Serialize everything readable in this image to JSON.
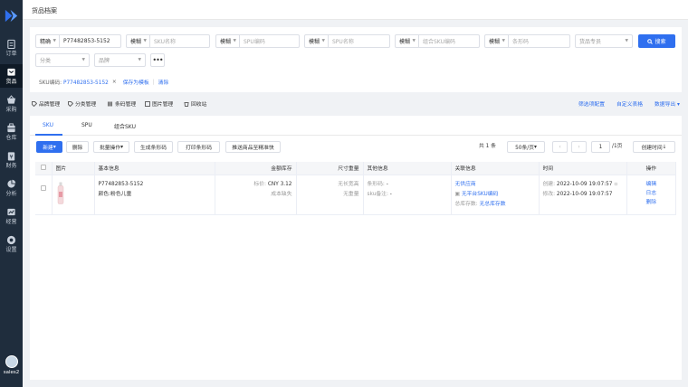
{
  "app": {
    "page_title": "货品档案",
    "user": "sales2"
  },
  "colors": {
    "brand": "#2f6fef",
    "sidebar": "#1f2d3d"
  },
  "sidebar": {
    "items": [
      {
        "label": "订单",
        "icon": "clipboard-icon"
      },
      {
        "label": "货品",
        "icon": "box-icon",
        "active": true
      },
      {
        "label": "采购",
        "icon": "basket-icon"
      },
      {
        "label": "仓库",
        "icon": "warehouse-icon"
      },
      {
        "label": "财务",
        "icon": "wallet-icon"
      },
      {
        "label": "分析",
        "icon": "pie-chart-icon"
      },
      {
        "label": "经营",
        "icon": "trend-icon"
      },
      {
        "label": "设置",
        "icon": "gear-icon"
      }
    ]
  },
  "search": {
    "f1": {
      "mode": "精确",
      "value": "P77482853-5152"
    },
    "f2": {
      "mode": "模糊",
      "placeholder": "SKU名称"
    },
    "f3": {
      "mode": "模糊",
      "placeholder": "SPU编码"
    },
    "f4": {
      "mode": "模糊",
      "placeholder": "SPU名称"
    },
    "f5": {
      "mode": "模糊",
      "placeholder": "组合SKU编码"
    },
    "f6": {
      "mode": "模糊",
      "placeholder": "条形码"
    },
    "owner": "货品专员",
    "category": "分类",
    "brand": "品牌",
    "more": "•••",
    "search_button": "搜索",
    "active_filter_label": "SKU编码:",
    "active_filter_value": "P77482853-5152",
    "remove": "×",
    "save_template": "保存为模板",
    "clear": "清除"
  },
  "toolbar": {
    "items": [
      "品牌管理",
      "分类管理",
      "条码管理",
      "图片管理",
      "回收站"
    ],
    "right": [
      "筛选项配置",
      "自定义表格",
      "数据导出"
    ]
  },
  "tabs": [
    "SKU",
    "SPU",
    "组合SKU"
  ],
  "actions": {
    "new": "新建",
    "delete": "删除",
    "batch": "批量操作",
    "gen_barcode": "生成条形码",
    "print_barcode": "打印条形码",
    "push": "推送商品至精准快"
  },
  "pager": {
    "total": "共 1 条",
    "page_size": "50条/页",
    "page": "1",
    "pages": "/1页",
    "sort": "创建时间"
  },
  "table": {
    "headers": [
      "图片",
      "基本信息",
      "金额库存",
      "尺寸重量",
      "其他信息",
      "关联信息",
      "时间",
      "操作"
    ],
    "rows": [
      {
        "sku": "P77482853-5152",
        "spec": "颜色:粉色儿童",
        "price_label": "标价:",
        "price": "CNY 3.12",
        "cost": "成本缺失",
        "size": "无长宽高",
        "weight": "无重量",
        "barcode_label": "条形码:",
        "barcode": "-",
        "remark_label": "sku备注:",
        "remark": "-",
        "supplier": "无供应商",
        "platform_sku": "无平台SKU编码",
        "stock_label": "总库存数:",
        "stock": "无总库存数",
        "created_label": "创建:",
        "created": "2022-10-09 19:07:57",
        "modified_label": "修改:",
        "modified": "2022-10-09 19:07:57",
        "op_edit": "编辑",
        "op_log": "日志",
        "op_delete": "删除"
      }
    ]
  }
}
